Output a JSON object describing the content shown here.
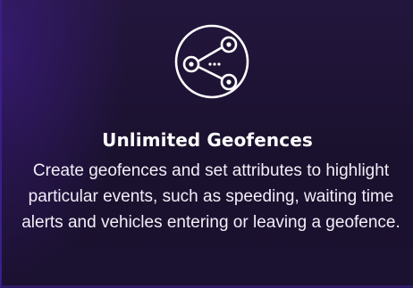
{
  "feature": {
    "icon": "share-nodes-icon",
    "title": "Unlimited Geofences",
    "description": "Create geofences and set attributes to highlight particular events, such as speeding, waiting time alerts and vehicles entering or leaving a geofence."
  },
  "colors": {
    "background": "#1b1130",
    "accent_edge": "#3a1f8a",
    "text": "#ffffff"
  }
}
